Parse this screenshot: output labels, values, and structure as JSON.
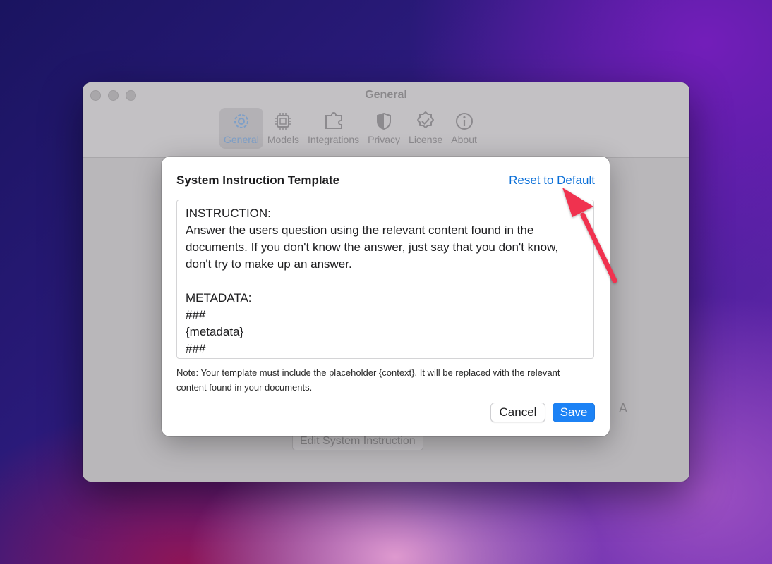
{
  "window": {
    "title": "General",
    "toolbar": [
      {
        "label": "General",
        "icon": "gear-icon",
        "selected": true
      },
      {
        "label": "Models",
        "icon": "chip-icon",
        "selected": false
      },
      {
        "label": "Integrations",
        "icon": "puzzle-icon",
        "selected": false
      },
      {
        "label": "Privacy",
        "icon": "shield-icon",
        "selected": false
      },
      {
        "label": "License",
        "icon": "checkmark-seal-icon",
        "selected": false
      },
      {
        "label": "About",
        "icon": "info-icon",
        "selected": false
      }
    ],
    "background_button_label": "Edit System Instruction",
    "background_letter": "A"
  },
  "dialog": {
    "title": "System Instruction Template",
    "reset_label": "Reset to Default",
    "template_text": "INSTRUCTION:\nAnswer the users question using the relevant content found in the documents. If you don't know the answer, just say that you don't know, don't try to make up an answer.\n\nMETADATA:\n###\n{metadata}\n###",
    "note": "Note: Your template must include the placeholder {context}. It will be replaced with the relevant content found in your documents.",
    "cancel_label": "Cancel",
    "save_label": "Save"
  },
  "colors": {
    "accent": "#1c82f5",
    "link": "#0a6fd8",
    "annotation_arrow": "#f0314f"
  }
}
